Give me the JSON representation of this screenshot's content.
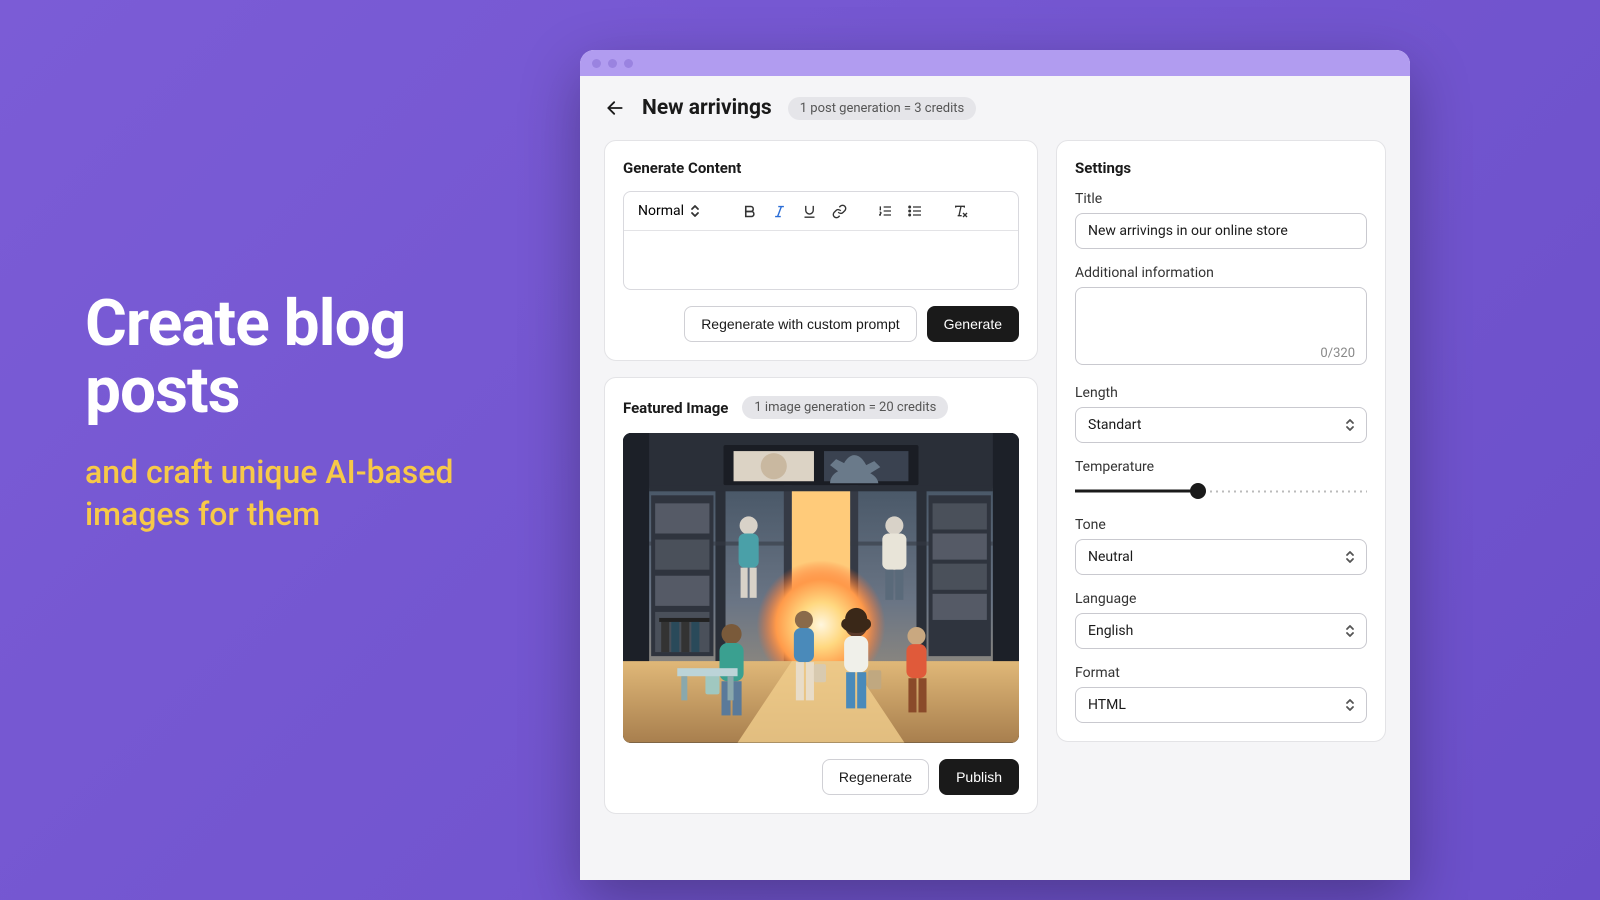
{
  "promo": {
    "headline": "Create blog posts",
    "subhead": "and craft unique AI-based images for them"
  },
  "header": {
    "title": "New arrivings",
    "credits_note": "1 post generation = 3 credits"
  },
  "generate": {
    "section_title": "Generate Content",
    "format_label": "Normal",
    "regenerate_label": "Regenerate with custom prompt",
    "generate_label": "Generate"
  },
  "featured": {
    "section_title": "Featured Image",
    "credits_note": "1 image generation = 20 credits",
    "regenerate_label": "Regenerate",
    "publish_label": "Publish"
  },
  "settings": {
    "section_title": "Settings",
    "title_label": "Title",
    "title_value": "New arrivings in our online store",
    "additional_label": "Additional information",
    "additional_value": "",
    "char_count": "0/320",
    "length_label": "Length",
    "length_value": "Standart",
    "temperature_label": "Temperature",
    "temperature_value": 0.42,
    "tone_label": "Tone",
    "tone_value": "Neutral",
    "language_label": "Language",
    "language_value": "English",
    "format_label": "Format",
    "format_value": "HTML"
  }
}
